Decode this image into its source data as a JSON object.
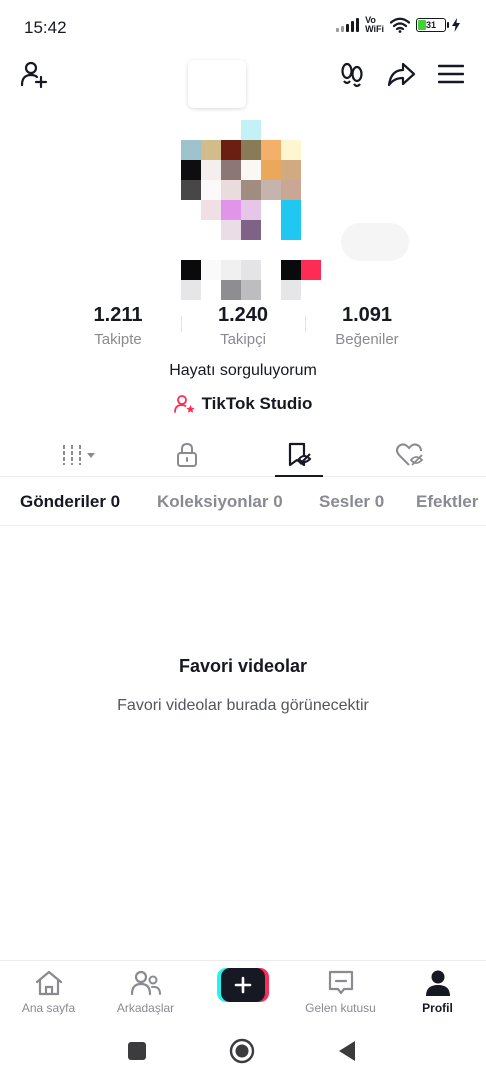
{
  "status_bar": {
    "time": "15:42",
    "volte_line1": "Vo",
    "volte_line2": "WiFi",
    "battery_level": 31,
    "battery_text": "31"
  },
  "top_nav": {
    "icons": [
      "add-friend-icon",
      "footprints-icon",
      "share-icon",
      "menu-icon"
    ]
  },
  "profile": {
    "stats": [
      {
        "value": "1.211",
        "label": "Takipte"
      },
      {
        "value": "1.240",
        "label": "Takipçi"
      },
      {
        "value": "1.091",
        "label": "Beğeniler"
      }
    ],
    "bio": "Hayatı sorguluyorum",
    "studio_label": "TikTok Studio"
  },
  "content_tabs": {
    "icons": [
      "grid-sort-icon",
      "lock-icon",
      "favorites-icon",
      "liked-icon"
    ],
    "active_index": 2
  },
  "sub_tabs": [
    {
      "label": "Gönderiler 0",
      "active": true
    },
    {
      "label": "Koleksiyonlar 0",
      "active": false
    },
    {
      "label": "Sesler 0",
      "active": false
    },
    {
      "label": "Efektler",
      "active": false
    }
  ],
  "empty_state": {
    "title": "Favori videolar",
    "description": "Favori videolar burada görünecektir"
  },
  "bottom_nav": {
    "items": [
      {
        "label": "Ana sayfa",
        "icon": "home-icon"
      },
      {
        "label": "Arkadaşlar",
        "icon": "friends-icon"
      },
      {
        "label": "",
        "icon": "create-icon"
      },
      {
        "label": "Gelen kutusu",
        "icon": "inbox-icon"
      },
      {
        "label": "Profil",
        "icon": "profile-icon"
      }
    ],
    "active_index": 4
  },
  "colors": {
    "primary_text": "#161823",
    "secondary_text": "#8a8b91",
    "accent_pink": "#fe2c55",
    "accent_cyan": "#25f4ee",
    "battery_green": "#42d234"
  }
}
